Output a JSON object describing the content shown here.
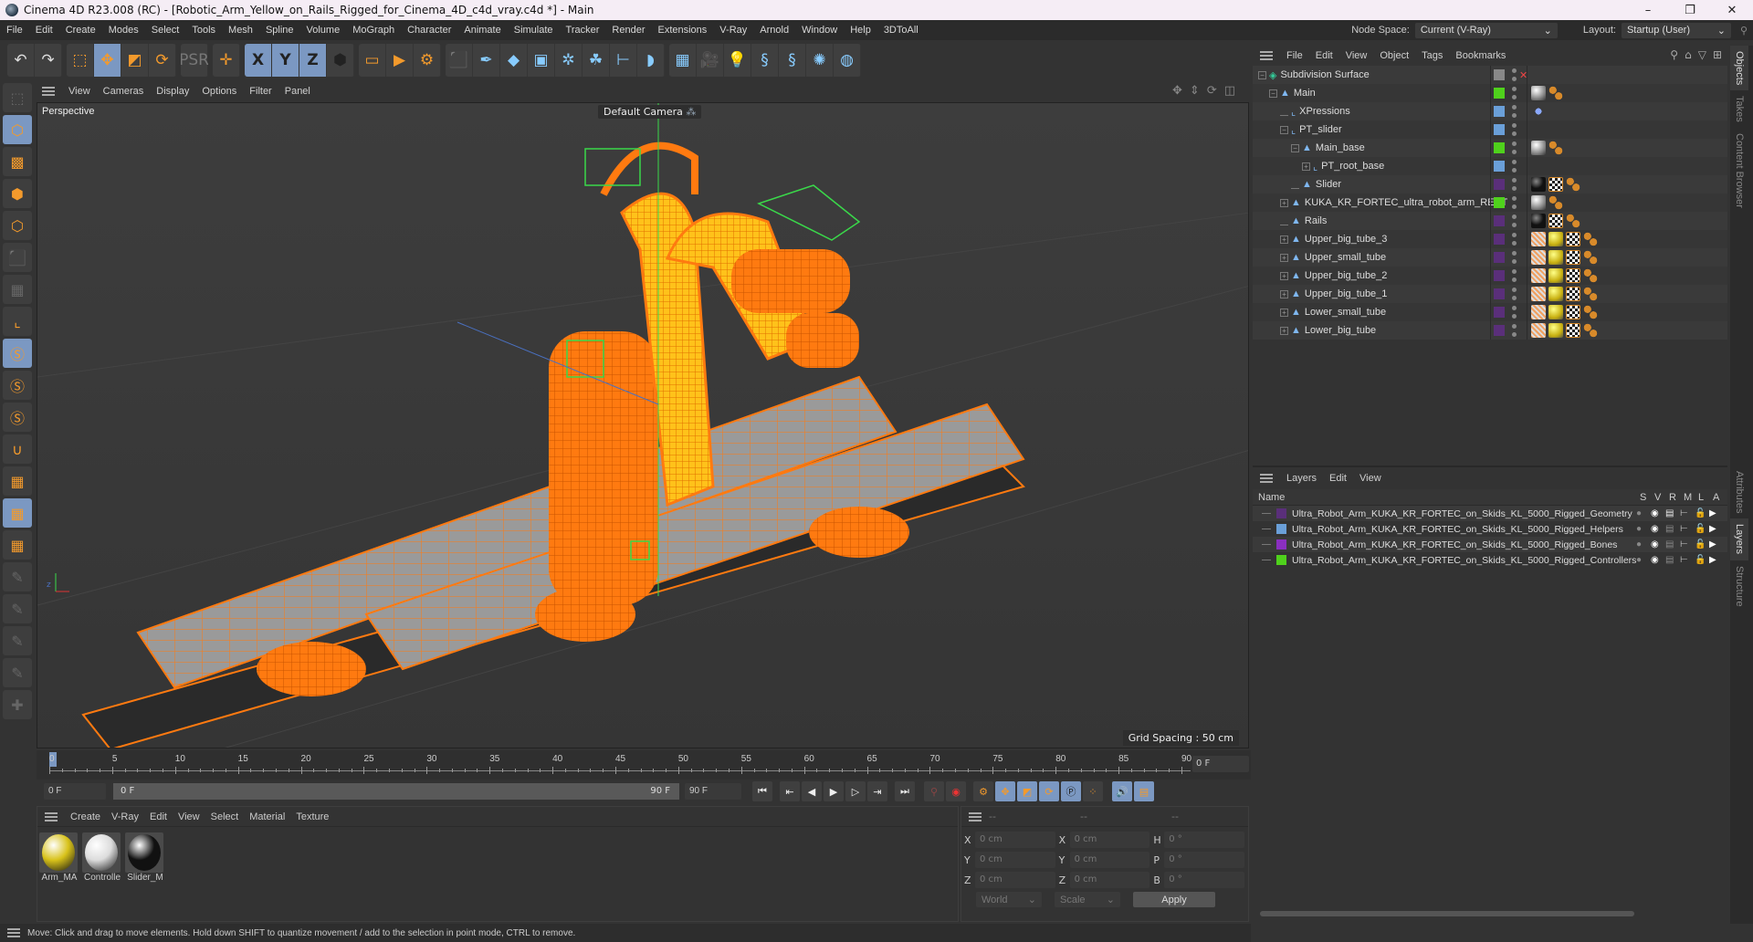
{
  "window": {
    "title": "Cinema 4D R23.008 (RC) - [Robotic_Arm_Yellow_on_Rails_Rigged_for_Cinema_4D_c4d_vray.c4d *] - Main",
    "controls": [
      "minimize",
      "maximize",
      "close"
    ]
  },
  "menubar": {
    "items": [
      "File",
      "Edit",
      "Create",
      "Modes",
      "Select",
      "Tools",
      "Mesh",
      "Spline",
      "Volume",
      "MoGraph",
      "Character",
      "Animate",
      "Simulate",
      "Tracker",
      "Render",
      "Extensions",
      "V-Ray",
      "Arnold",
      "Window",
      "Help",
      "3DToAll"
    ],
    "node_space_label": "Node Space:",
    "node_space_value": "Current (V-Ray)",
    "layout_label": "Layout:",
    "layout_value": "Startup (User)"
  },
  "toolbar": {
    "groups": [
      [
        {
          "name": "undo",
          "glyph": "↶"
        },
        {
          "name": "redo",
          "glyph": "↷"
        }
      ],
      [
        {
          "name": "live-selection",
          "glyph": "⬚"
        },
        {
          "name": "move",
          "glyph": "✥",
          "active": true
        },
        {
          "name": "scale",
          "glyph": "◩"
        },
        {
          "name": "rotate",
          "glyph": "⟳"
        }
      ],
      [
        {
          "name": "psr",
          "glyph": "PSR"
        }
      ],
      [
        {
          "name": "world-axis",
          "glyph": "✛"
        }
      ],
      [
        {
          "name": "x-axis-lock",
          "glyph": "X",
          "active": true
        },
        {
          "name": "y-axis-lock",
          "glyph": "Y",
          "active": true
        },
        {
          "name": "z-axis-lock",
          "glyph": "Z",
          "active": true
        },
        {
          "name": "coordinate-system",
          "glyph": "⬢"
        }
      ],
      [
        {
          "name": "render-view",
          "glyph": "▭"
        },
        {
          "name": "render-picture-viewer",
          "glyph": "▶"
        },
        {
          "name": "render-settings",
          "glyph": "⚙"
        }
      ],
      [
        {
          "name": "cube",
          "glyph": "⬛"
        },
        {
          "name": "pen-spline",
          "glyph": "✒"
        },
        {
          "name": "subdivision-surface",
          "glyph": "◆"
        },
        {
          "name": "extrude",
          "glyph": "▣"
        },
        {
          "name": "cloner",
          "glyph": "✲"
        },
        {
          "name": "mograph-array",
          "glyph": "☘"
        },
        {
          "name": "deformer",
          "glyph": "⊢"
        },
        {
          "name": "bend",
          "glyph": "◗"
        }
      ],
      [
        {
          "name": "floor",
          "glyph": "▦"
        },
        {
          "name": "camera",
          "glyph": "🎥"
        },
        {
          "name": "light",
          "glyph": "💡"
        },
        {
          "name": "python-1",
          "glyph": "§"
        },
        {
          "name": "python-2",
          "glyph": "§"
        },
        {
          "name": "gear-plugin",
          "glyph": "✺"
        },
        {
          "name": "sphere-wire",
          "glyph": "◍"
        }
      ]
    ]
  },
  "left_tools": [
    "make-editable",
    "model-mode",
    "texture-mode",
    "point-mode",
    "edge-mode",
    "polygon-mode",
    "uv-mode",
    "axis-mode",
    "solo-off",
    "solo-single",
    "solo-hierarchy",
    "snap",
    "workplane",
    "locked-workplane",
    "workplane-align",
    "pin-1",
    "pin-p",
    "pin-r",
    "pin-target",
    "add-joint"
  ],
  "viewport": {
    "menu": [
      "View",
      "Cameras",
      "Display",
      "Options",
      "Filter",
      "Panel"
    ],
    "label": "Perspective",
    "camera": "Default Camera",
    "grid_spacing": "Grid Spacing : 50 cm"
  },
  "timeline": {
    "ticks": [
      "0",
      "5",
      "10",
      "15",
      "20",
      "25",
      "30",
      "35",
      "40",
      "45",
      "50",
      "55",
      "60",
      "65",
      "70",
      "75",
      "80",
      "85",
      "90"
    ],
    "current_frame": "0 F",
    "start_field": "0 F",
    "range_start": "0 F",
    "range_end": "90 F",
    "end_field": "90 F",
    "playhead": 0
  },
  "materials": {
    "menu": [
      "Create",
      "V-Ray",
      "Edit",
      "View",
      "Select",
      "Material",
      "Texture"
    ],
    "items": [
      {
        "name": "Arm_MA",
        "color": "#d8c21a"
      },
      {
        "name": "Controlle",
        "color": "#dcdcdc"
      },
      {
        "name": "Slider_M",
        "color": "#111111"
      }
    ]
  },
  "coords": {
    "headers": [
      "--",
      "--",
      "--"
    ],
    "rows": [
      {
        "a": "X",
        "v1": "0 cm",
        "b": "X",
        "v2": "0 cm",
        "c": "H",
        "v3": "0 °"
      },
      {
        "a": "Y",
        "v1": "0 cm",
        "b": "Y",
        "v2": "0 cm",
        "c": "P",
        "v3": "0 °"
      },
      {
        "a": "Z",
        "v1": "0 cm",
        "b": "Z",
        "v2": "0 cm",
        "c": "B",
        "v3": "0 °"
      }
    ],
    "mode": "World",
    "transform": "Scale",
    "apply": "Apply"
  },
  "status": "Move: Click and drag to move elements. Hold down SHIFT to quantize movement / add to the selection in point mode, CTRL to remove.",
  "objects": {
    "menu": [
      "File",
      "Edit",
      "View",
      "Object",
      "Tags",
      "Bookmarks"
    ],
    "rows": [
      {
        "name": "Subdivision Surface",
        "indent": 0,
        "exp": "-",
        "icon": "subdiv",
        "color": "#888888",
        "tags": []
      },
      {
        "name": "Main",
        "indent": 1,
        "exp": "-",
        "icon": "null",
        "color": "#4fd11c",
        "tags": [
          "mat-gray",
          "bones"
        ]
      },
      {
        "name": "XPressions",
        "indent": 2,
        "exp": "",
        "icon": "point",
        "color": "#6a9fd8",
        "tags": [
          "xpresso"
        ]
      },
      {
        "name": "PT_slider",
        "indent": 2,
        "exp": "-",
        "icon": "point",
        "color": "#6a9fd8",
        "tags": []
      },
      {
        "name": "Main_base",
        "indent": 3,
        "exp": "-",
        "icon": "null",
        "color": "#4fd11c",
        "tags": [
          "mat-gray",
          "bones"
        ]
      },
      {
        "name": "PT_root_base",
        "indent": 4,
        "exp": "+",
        "icon": "point",
        "color": "#6a9fd8",
        "tags": []
      },
      {
        "name": "Slider",
        "indent": 3,
        "exp": "",
        "icon": "null",
        "color": "#5a2f7a",
        "tags": [
          "mat-black",
          "checker",
          "bones"
        ]
      },
      {
        "name": "KUKA_KR_FORTEC_ultra_robot_arm_RECT",
        "indent": 2,
        "exp": "+",
        "icon": "null",
        "color": "#4fd11c",
        "tags": [
          "mat-gray",
          "bones"
        ]
      },
      {
        "name": "Rails",
        "indent": 2,
        "exp": "",
        "icon": "null",
        "color": "#5a2f7a",
        "tags": [
          "mat-black",
          "checker",
          "bones"
        ]
      },
      {
        "name": "Upper_big_tube_3",
        "indent": 2,
        "exp": "+",
        "icon": "null",
        "color": "#5a2f7a",
        "tags": [
          "weight",
          "mat-yellow",
          "checker",
          "bones"
        ]
      },
      {
        "name": "Upper_small_tube",
        "indent": 2,
        "exp": "+",
        "icon": "null",
        "color": "#5a2f7a",
        "tags": [
          "weight",
          "mat-yellow",
          "checker",
          "bones"
        ]
      },
      {
        "name": "Upper_big_tube_2",
        "indent": 2,
        "exp": "+",
        "icon": "null",
        "color": "#5a2f7a",
        "tags": [
          "weight",
          "mat-yellow",
          "checker",
          "bones"
        ]
      },
      {
        "name": "Upper_big_tube_1",
        "indent": 2,
        "exp": "+",
        "icon": "null",
        "color": "#5a2f7a",
        "tags": [
          "weight",
          "mat-yellow",
          "checker",
          "bones"
        ]
      },
      {
        "name": "Lower_small_tube",
        "indent": 2,
        "exp": "+",
        "icon": "null",
        "color": "#5a2f7a",
        "tags": [
          "weight",
          "mat-yellow",
          "checker",
          "bones"
        ]
      },
      {
        "name": "Lower_big_tube",
        "indent": 2,
        "exp": "+",
        "icon": "null",
        "color": "#5a2f7a",
        "tags": [
          "weight",
          "mat-yellow",
          "checker",
          "bones"
        ]
      }
    ]
  },
  "layers": {
    "menu": [
      "Layers",
      "Edit",
      "View"
    ],
    "columns": [
      "Name",
      "S",
      "V",
      "R",
      "M",
      "L",
      "A"
    ],
    "rows": [
      {
        "name": "Ultra_Robot_Arm_KUKA_KR_FORTEC_on_Skids_KL_5000_Rigged_Geometry",
        "color": "#5a2f7a"
      },
      {
        "name": "Ultra_Robot_Arm_KUKA_KR_FORTEC_on_Skids_KL_5000_Rigged_Helpers",
        "color": "#6a9fd8"
      },
      {
        "name": "Ultra_Robot_Arm_KUKA_KR_FORTEC_on_Skids_KL_5000_Rigged_Bones",
        "color": "#8a2fc0"
      },
      {
        "name": "Ultra_Robot_Arm_KUKA_KR_FORTEC_on_Skids_KL_5000_Rigged_Controllers",
        "color": "#4fd11c"
      }
    ]
  },
  "side_tabs_top": [
    "Objects",
    "Takes",
    "Content Browser"
  ],
  "side_tabs_bottom": [
    "Attributes",
    "Layers",
    "Structure"
  ]
}
